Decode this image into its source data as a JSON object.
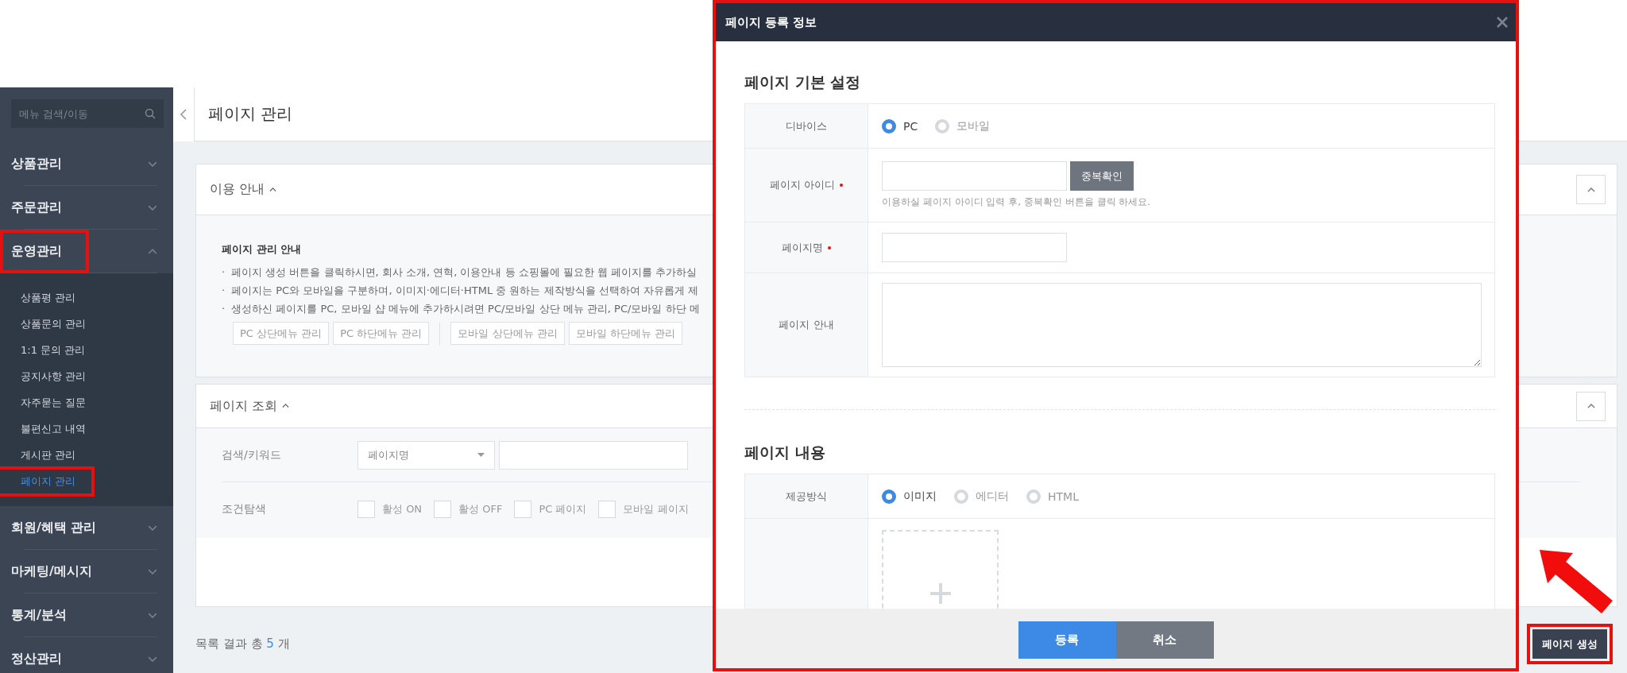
{
  "sidebar": {
    "search": {
      "placeholder": "메뉴 검색/이동"
    },
    "menu": [
      {
        "label": "상품관리",
        "expanded": false,
        "highlighted": false
      },
      {
        "label": "주문관리",
        "expanded": false,
        "highlighted": false
      },
      {
        "label": "운영관리",
        "expanded": true,
        "highlighted": true,
        "children": [
          {
            "label": "상품평 관리",
            "selected": false,
            "highlighted": false
          },
          {
            "label": "상품문의 관리",
            "selected": false,
            "highlighted": false
          },
          {
            "label": "1:1 문의 관리",
            "selected": false,
            "highlighted": false
          },
          {
            "label": "공지사항 관리",
            "selected": false,
            "highlighted": false
          },
          {
            "label": "자주묻는 질문",
            "selected": false,
            "highlighted": false
          },
          {
            "label": "불편신고 내역",
            "selected": false,
            "highlighted": false
          },
          {
            "label": "게시판 관리",
            "selected": false,
            "highlighted": false
          },
          {
            "label": "페이지 관리",
            "selected": true,
            "highlighted": true
          }
        ]
      },
      {
        "label": "회원/혜택 관리",
        "expanded": false,
        "highlighted": false
      },
      {
        "label": "마케팅/메시지",
        "expanded": false,
        "highlighted": false
      },
      {
        "label": "통계/분석",
        "expanded": false,
        "highlighted": false
      },
      {
        "label": "정산관리",
        "expanded": false,
        "highlighted": false
      }
    ]
  },
  "header": {
    "title": "페이지 관리"
  },
  "guide_panel": {
    "title": "이용 안내",
    "expanded": true,
    "heading": "페이지 관리 안내",
    "bullet_mark": "·",
    "bullets": [
      "페이지 생성 버튼을 클릭하시면, 회사 소개, 연혁, 이용안내 등 쇼핑몰에 필요한 웹 페이지를 추가하실",
      "페이지는 PC와 모바일을 구분하며, 이미지·에디터·HTML 중 원하는 제작방식을 선택하여 자유롭게 제",
      "생성하신 페이지를 PC, 모바일 샵 메뉴에 추가하시려면 PC/모바일 상단 메뉴 관리, PC/모바일 하단 메"
    ],
    "button_groups": [
      [
        "PC 상단메뉴 관리",
        "PC 하단메뉴 관리"
      ],
      [
        "모바일 상단메뉴 관리",
        "모바일 하단메뉴 관리"
      ]
    ]
  },
  "search_panel": {
    "title": "페이지 조회",
    "expanded": true,
    "keyword_label": "검색/키워드",
    "keyword_select": "페이지명",
    "condition_label": "조건탐색",
    "conditions": [
      {
        "label": "활성 ON",
        "checked": false
      },
      {
        "label": "활성 OFF",
        "checked": false
      },
      {
        "label": "PC 페이지",
        "checked": false
      },
      {
        "label": "모바일 페이지",
        "checked": false
      }
    ]
  },
  "result_count": {
    "label": "목록 결과 총",
    "count": "5",
    "unit": "개"
  },
  "create_button": {
    "label": "페이지 생성",
    "highlighted": true
  },
  "dialog": {
    "title": "페이지 등록 정보",
    "highlighted": true,
    "sections": [
      {
        "title": "페이지 기본 설정",
        "rows": [
          {
            "kind": "radio",
            "label": "디바이스",
            "required": false,
            "options": [
              {
                "label": "PC",
                "selected": true
              },
              {
                "label": "모바일",
                "selected": false
              }
            ]
          },
          {
            "kind": "input_with_button",
            "label": "페이지 아이디",
            "required": true,
            "button": "중복확인",
            "help": "이용하실 페이지 아이디 입력 후, 중복확인 버튼을 클릭 하세요."
          },
          {
            "kind": "input",
            "label": "페이지명",
            "required": true
          },
          {
            "kind": "textarea",
            "label": "페이지 안내",
            "required": false
          }
        ]
      },
      {
        "title": "페이지 내용",
        "rows": [
          {
            "kind": "radio",
            "label": "제공방식",
            "required": false,
            "options": [
              {
                "label": "이미지",
                "selected": true
              },
              {
                "label": "에디터",
                "selected": false
              },
              {
                "label": "HTML",
                "selected": false
              }
            ]
          },
          {
            "kind": "upload",
            "required": false
          }
        ]
      }
    ],
    "buttons": [
      {
        "label": "등록",
        "kind": "primary"
      },
      {
        "label": "취소",
        "kind": "secondary"
      }
    ]
  }
}
